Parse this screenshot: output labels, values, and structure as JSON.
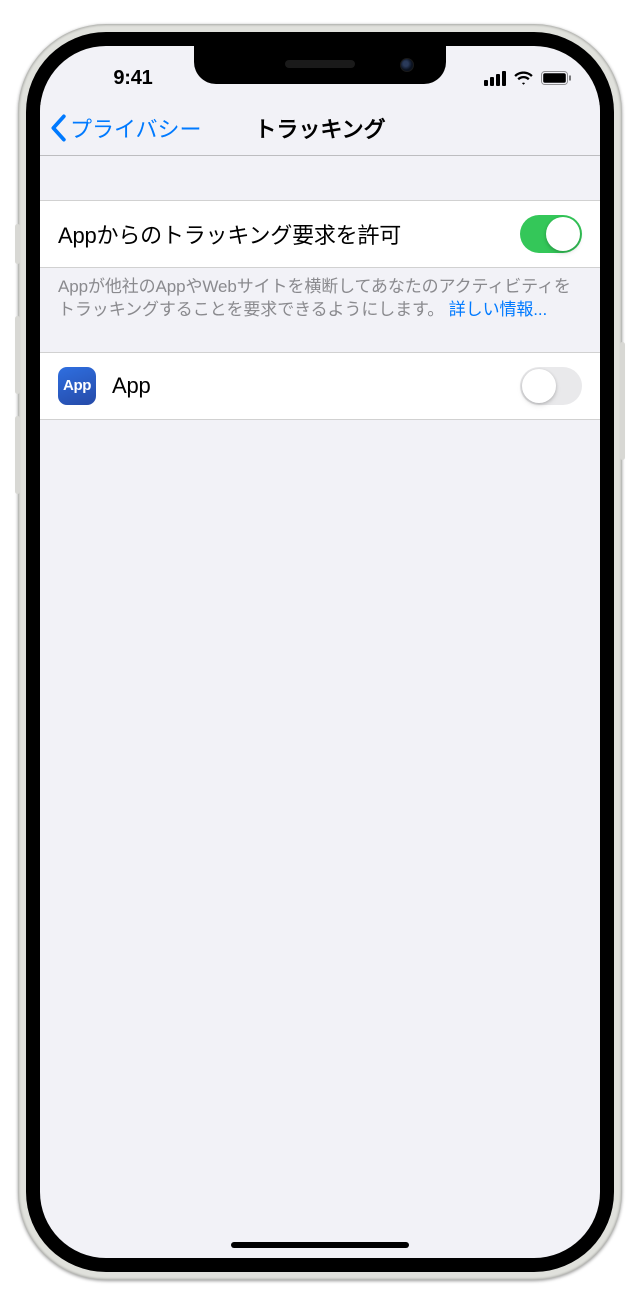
{
  "status": {
    "time": "9:41"
  },
  "nav": {
    "back_label": "プライバシー",
    "title": "トラッキング"
  },
  "main_toggle": {
    "label": "Appからのトラッキング要求を許可",
    "enabled": true
  },
  "footer": {
    "text": "Appが他社のAppやWebサイトを横断してあなたのアクティビティをトラッキングすることを要求できるようにします。",
    "link_text": "詳しい情報..."
  },
  "apps": [
    {
      "icon_label": "App",
      "name": "App",
      "enabled": false
    }
  ]
}
